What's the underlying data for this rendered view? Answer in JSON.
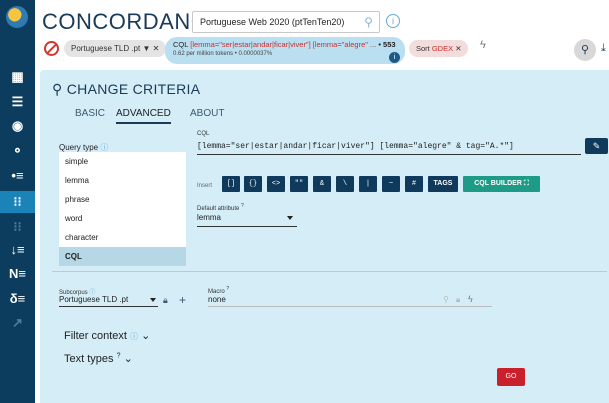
{
  "header": {
    "app_title": "CONCORDANCE",
    "corpus": "Portuguese Web 2020 (ptTenTen20)"
  },
  "ops": {
    "subcorpus_chip": "Portuguese TLD .pt ▼  ✕",
    "cql_prefix": "CQL ",
    "cql_query": "[lemma=\"ser|estar|andar|ficar|viver\"] [lemma=\"alegre\" ...",
    "cql_count": " • 553",
    "cql_stats": "0.62 per million tokens • 0.0000037%",
    "cql_badge": "i",
    "sort_prefix": "Sort ",
    "sort_value": "GDEX",
    "sort_close": " ✕"
  },
  "rail": {
    "icons": [
      "dashboard-icon",
      "list-icon",
      "target-icon",
      "concordance-icon",
      "keyword-icon",
      "kwic-icon",
      "wordlist-icon",
      "sort-icon",
      "ngram-icon",
      "words-icon",
      "trend-icon"
    ]
  },
  "panel": {
    "title": "CHANGE CRITERIA",
    "tabs": [
      "BASIC",
      "ADVANCED",
      "ABOUT"
    ],
    "query_type_label": "Query type",
    "query_types": [
      "simple",
      "lemma",
      "phrase",
      "word",
      "character",
      "CQL"
    ],
    "selected_query_type": "CQL",
    "cql_label": "CQL",
    "cql_value": "[lemma=\"ser|estar|andar|ficar|viver\"] [lemma=\"alegre\" & tag=\"A.*\"]",
    "insert_label": "Insert",
    "insert_buttons": [
      "[]",
      "{}",
      "<>",
      "\"\"",
      "&",
      "\\",
      "|",
      "~",
      "#"
    ],
    "tags_button": "TAGS",
    "cql_builder_button": "CQL BUILDER",
    "default_attr_label": "Default attribute",
    "default_attr_value": "lemma",
    "subcorpus_label": "Subcorpus",
    "subcorpus_value": "Portuguese TLD .pt",
    "macro_label": "Macro",
    "macro_value": "none",
    "filter_context": "Filter context",
    "text_types": "Text types",
    "go_button": "GO"
  },
  "colors": {
    "rail": "#0c3d5e",
    "panel": "#d4edf6",
    "accent_dark": "#0f3a5b",
    "accent_green": "#1d9b86",
    "go_red": "#c9202c"
  }
}
